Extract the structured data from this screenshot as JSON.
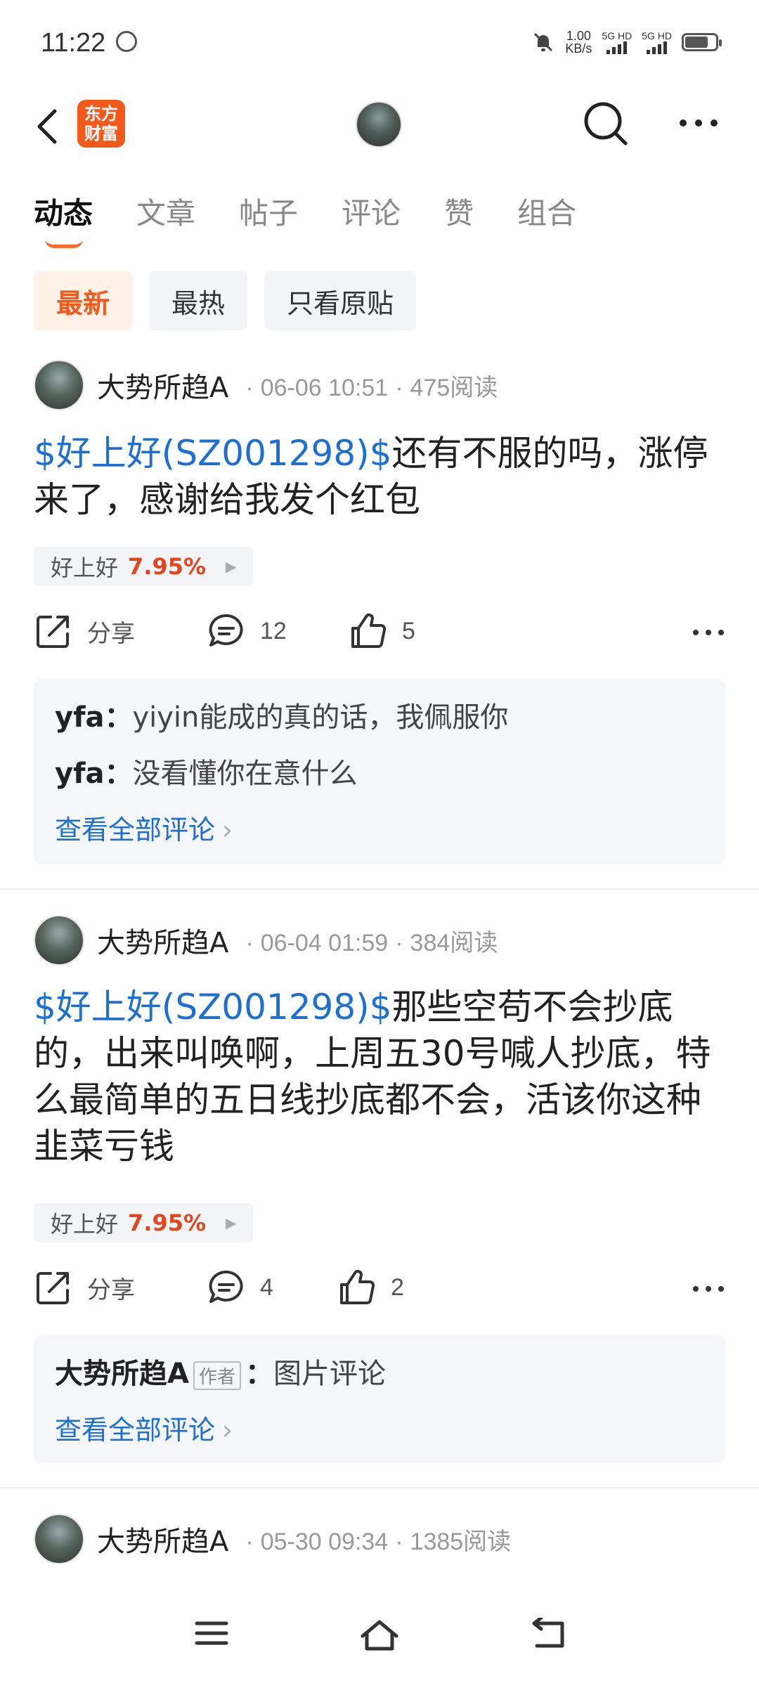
{
  "status_bar": {
    "time": "11:22",
    "net_speed_value": "1.00",
    "net_speed_unit": "KB/s",
    "sim1": "5G HD",
    "sim2": "5G HD"
  },
  "header": {
    "logo_line1": "东方",
    "logo_line2": "财富"
  },
  "tabs": [
    {
      "label": "动态",
      "active": true
    },
    {
      "label": "文章",
      "active": false
    },
    {
      "label": "帖子",
      "active": false
    },
    {
      "label": "评论",
      "active": false
    },
    {
      "label": "赞",
      "active": false
    },
    {
      "label": "组合",
      "active": false
    }
  ],
  "filters": [
    {
      "label": "最新",
      "active": true
    },
    {
      "label": "最热",
      "active": false
    },
    {
      "label": "只看原贴",
      "active": false
    }
  ],
  "posts": [
    {
      "author": "大势所趋A",
      "date": "06-06 10:51",
      "reads": "475阅读",
      "stock_link": "$好上好(SZ001298)$",
      "text_line1": "还有不服的吗，涨停",
      "text_rest": "来了，感谢给我发个红包",
      "stock_name": "好上好",
      "stock_change": "7.95%",
      "share_label": "分享",
      "comment_count": "12",
      "like_count": "5",
      "comments": [
        {
          "user": "yfa",
          "sep": "：",
          "text": "yiyin能成的真的话，我佩服你"
        },
        {
          "user": "yfa",
          "sep": "：",
          "text": "没看懂你在意什么"
        }
      ],
      "view_all": "查看全部评论"
    },
    {
      "author": "大势所趋A",
      "date": "06-04 01:59",
      "reads": "384阅读",
      "stock_link": "$好上好(SZ001298)$",
      "text_line1": "那些空苟不会抄底",
      "text_rest": "的，出来叫唤啊，上周五30号喊人抄底，特么最简单的五日线抄底都不会，活该你这种韭菜亏钱",
      "stock_name": "好上好",
      "stock_change": "7.95%",
      "share_label": "分享",
      "comment_count": "4",
      "like_count": "2",
      "comments": [
        {
          "user": "大势所趋A",
          "tag": "作者",
          "sep": "：",
          "text": "图片评论"
        }
      ],
      "view_all": "查看全部评论"
    },
    {
      "author": "大势所趋A",
      "date": "05-30 09:34",
      "reads": "1385阅读"
    }
  ]
}
